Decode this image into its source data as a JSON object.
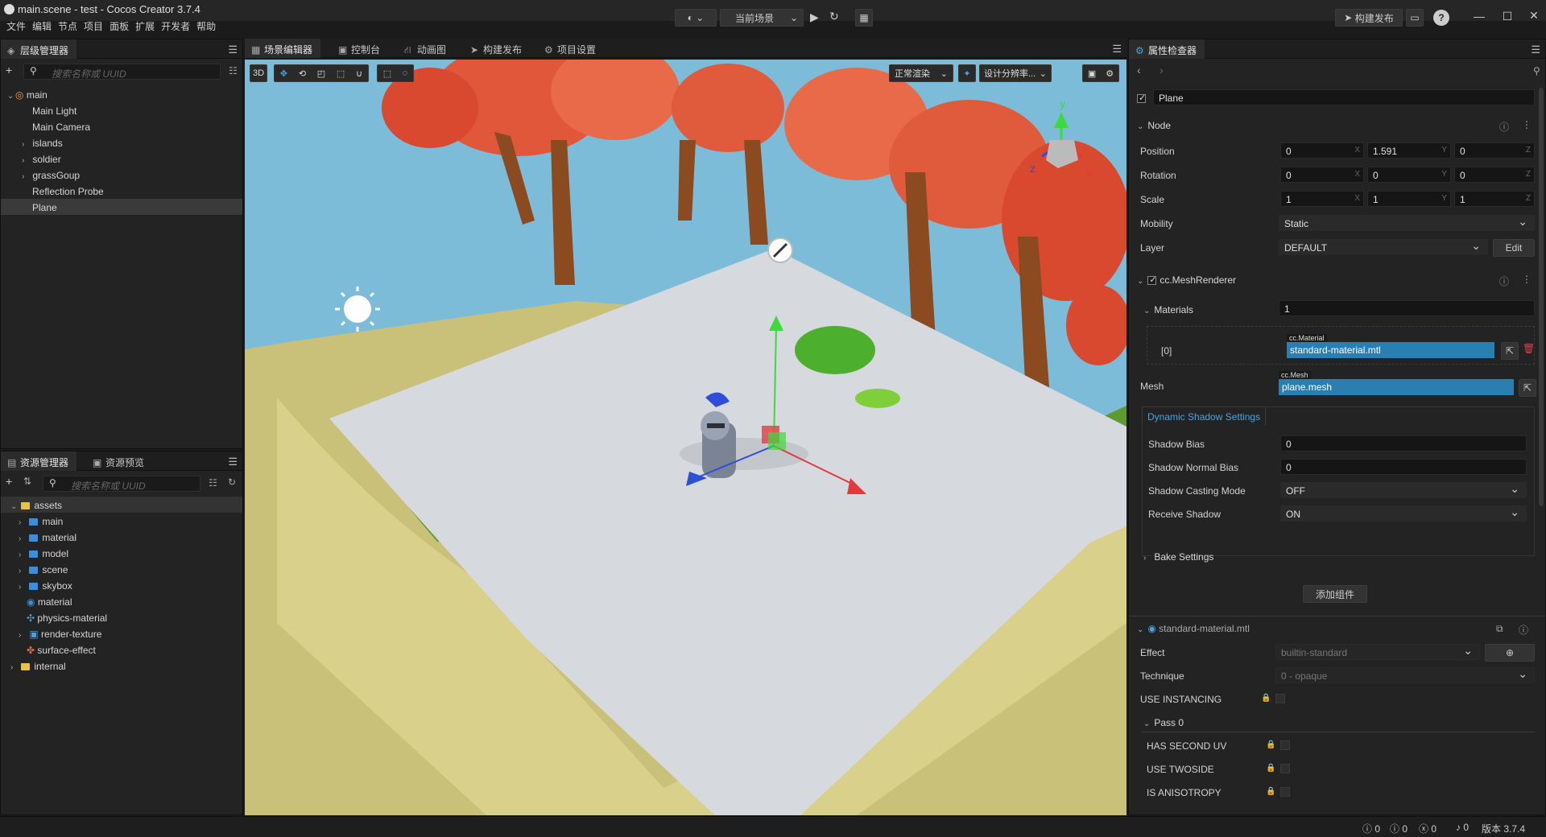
{
  "window": {
    "title": "main.scene - test - Cocos Creator 3.7.4",
    "menu": [
      "文件",
      "编辑",
      "节点",
      "项目",
      "面板",
      "扩展",
      "开发者",
      "帮助"
    ],
    "scene_selector": "当前场景",
    "build_publish": "构建发布"
  },
  "hierarchy": {
    "tab": "层级管理器",
    "search_placeholder": "搜索名称或 UUID",
    "nodes": [
      {
        "label": "main",
        "caret": "⌄"
      },
      {
        "label": "Main Light",
        "caret": ""
      },
      {
        "label": "Main Camera",
        "caret": ""
      },
      {
        "label": "islands",
        "caret": "›"
      },
      {
        "label": "soldier",
        "caret": "›"
      },
      {
        "label": "grassGoup",
        "caret": "›"
      },
      {
        "label": "Reflection Probe",
        "caret": ""
      },
      {
        "label": "Plane",
        "caret": ""
      }
    ]
  },
  "assets": {
    "tab_assets": "资源管理器",
    "tab_preview": "资源预览",
    "search_placeholder": "搜索名称或 UUID",
    "items": [
      {
        "label": "assets",
        "caret": "⌄"
      },
      {
        "label": "main",
        "caret": "›"
      },
      {
        "label": "material",
        "caret": "›"
      },
      {
        "label": "model",
        "caret": "›"
      },
      {
        "label": "scene",
        "caret": "›"
      },
      {
        "label": "skybox",
        "caret": "›"
      },
      {
        "label": "material",
        "caret": ""
      },
      {
        "label": "physics-material",
        "caret": ""
      },
      {
        "label": "render-texture",
        "caret": "›"
      },
      {
        "label": "surface-effect",
        "caret": ""
      },
      {
        "label": "internal",
        "caret": "›"
      }
    ]
  },
  "center_tabs": [
    "场景编辑器",
    "控制台",
    "动画图",
    "构建发布",
    "项目设置"
  ],
  "scene_toolbar": {
    "mode_3d": "3D",
    "render_mode": "正常渲染",
    "resolution": "设计分辨率..."
  },
  "inspector": {
    "tab": "属性检查器",
    "node_name": "Plane",
    "node_section": "Node",
    "position": {
      "label": "Position",
      "x": "0",
      "y": "1.591",
      "z": "0"
    },
    "rotation": {
      "label": "Rotation",
      "x": "0",
      "y": "0",
      "z": "0"
    },
    "scale": {
      "label": "Scale",
      "x": "1",
      "y": "1",
      "z": "1"
    },
    "mobility": {
      "label": "Mobility",
      "value": "Static"
    },
    "layer": {
      "label": "Layer",
      "value": "DEFAULT",
      "edit": "Edit"
    },
    "mesh_renderer": "cc.MeshRenderer",
    "materials": {
      "label": "Materials",
      "count": "1",
      "index": "[0]",
      "tag": "cc.Material",
      "value": "standard-material.mtl"
    },
    "mesh": {
      "label": "Mesh",
      "tag": "cc.Mesh",
      "value": "plane.mesh"
    },
    "dynamic_shadow_tab": "Dynamic Shadow Settings",
    "shadow_bias": {
      "label": "Shadow Bias",
      "value": "0"
    },
    "shadow_normal_bias": {
      "label": "Shadow Normal Bias",
      "value": "0"
    },
    "shadow_casting_mode": {
      "label": "Shadow Casting Mode",
      "value": "OFF"
    },
    "receive_shadow": {
      "label": "Receive Shadow",
      "value": "ON"
    },
    "bake_settings": "Bake Settings",
    "add_component": "添加组件",
    "material_section": "standard-material.mtl",
    "effect": {
      "label": "Effect",
      "value": "builtin-standard"
    },
    "technique": {
      "label": "Technique",
      "value": "0 - opaque"
    },
    "use_instancing": "USE INSTANCING",
    "pass0": "Pass 0",
    "has_second_uv": "HAS SECOND UV",
    "use_twoside": "USE TWOSIDE",
    "is_anisotropy": "IS ANISOTROPY"
  },
  "status": {
    "info": "0",
    "warn": "0",
    "error": "0",
    "notify": "0",
    "version": "版本 3.7.4"
  },
  "colors": {
    "accent": "#2a7fb0",
    "tab_link": "#4aa3df",
    "sky": "#7dbcd9",
    "plane": "#d6d9dd"
  }
}
